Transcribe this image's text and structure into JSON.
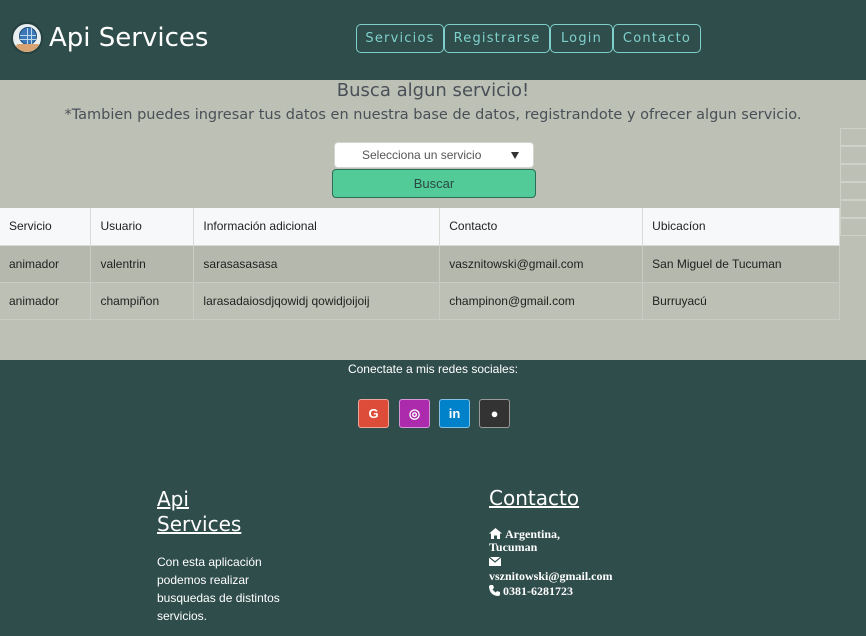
{
  "header": {
    "brand": "Api Services",
    "nav": [
      "Servicios",
      "Registrarse",
      "Login",
      "Contacto"
    ]
  },
  "search": {
    "title": "Busca algun servicio!",
    "subtitle": "*Tambien puedes ingresar tus datos en nuestra base de datos, registrandote y ofrecer algun servicio.",
    "select_value": "Selecciona un servicio",
    "button": "Buscar"
  },
  "table": {
    "columns": [
      "Servicio",
      "Usuario",
      "Información adicional",
      "Contacto",
      "Ubicacíon"
    ],
    "rows": [
      [
        "animador",
        "valentrin",
        "sarasasasasa",
        "vasznitowski@gmail.com",
        "San Miguel de Tucuman"
      ],
      [
        "animador",
        "champiñon",
        "larasadaiosdjqowidj qowidjoijoij",
        "champinon@gmail.com",
        "Burruyacú"
      ]
    ]
  },
  "footer": {
    "social_heading": "Conectate a mis redes sociales:",
    "social": [
      {
        "name": "google",
        "glyph": "G",
        "color": "#dd4b39"
      },
      {
        "name": "instagram",
        "glyph": "◎",
        "color": "#ac2bac"
      },
      {
        "name": "linkedin",
        "glyph": "in",
        "color": "#0082ca"
      },
      {
        "name": "github",
        "glyph": "●",
        "color": "#333333"
      }
    ],
    "brand": "Api Services",
    "description": "Con esta aplicación podemos realizar busquedas de distintos servicios.",
    "contact_title": "Contacto",
    "location": "Argentina, Tucuman",
    "email": "vsznitowski@gmail.com",
    "phone": "0381-6281723"
  }
}
